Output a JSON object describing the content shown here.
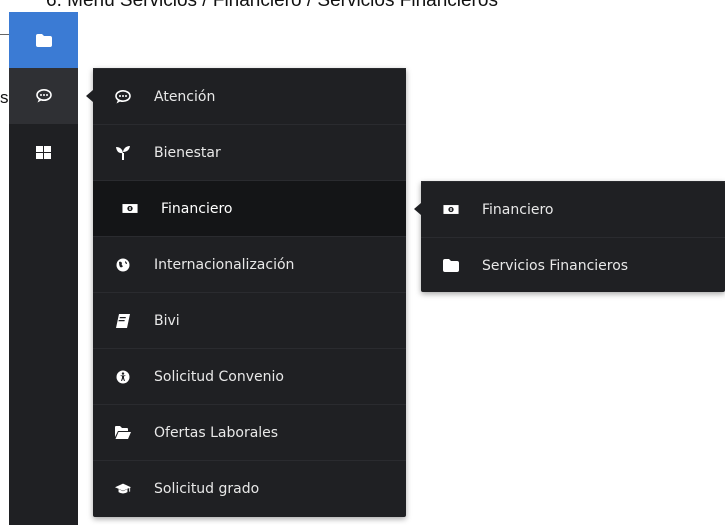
{
  "page": {
    "caption": "6. Menú Servicios / Financiero / Servicios Financieros",
    "left_stub": "s"
  },
  "rail": [
    {
      "name": "folder",
      "icon": "folder-icon"
    },
    {
      "name": "chat",
      "icon": "chat-bubble-icon"
    },
    {
      "name": "apps",
      "icon": "grid-icon"
    }
  ],
  "main_menu": {
    "items": [
      {
        "label": "Atención",
        "icon": "chat-bubble-icon"
      },
      {
        "label": "Bienestar",
        "icon": "sprout-icon"
      },
      {
        "label": "Financiero",
        "icon": "money-icon",
        "active": true
      },
      {
        "label": "Internacionalización",
        "icon": "globe-icon"
      },
      {
        "label": "Bivi",
        "icon": "book-icon"
      },
      {
        "label": "Solicitud Convenio",
        "icon": "accessibility-icon"
      },
      {
        "label": "Ofertas Laborales",
        "icon": "folder-open-icon"
      },
      {
        "label": "Solicitud grado",
        "icon": "graduation-cap-icon"
      }
    ]
  },
  "sub_menu": {
    "items": [
      {
        "label": "Financiero",
        "icon": "money-icon"
      },
      {
        "label": "Servicios Financieros",
        "icon": "folder-icon"
      }
    ]
  },
  "colors": {
    "rail_bg": "#1f2023",
    "rail_active": "#3b7bd4",
    "menu_bg": "#1f2023",
    "active_item_bg": "#141517"
  }
}
